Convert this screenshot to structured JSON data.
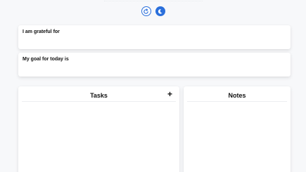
{
  "header": {
    "refresh_icon": "refresh-icon",
    "theme_icon": "moon-icon",
    "accent_color": "#2a6fdb"
  },
  "journal": {
    "grateful_label": "I am grateful for",
    "grateful_value": "",
    "goal_label": "My goal for today is",
    "goal_value": ""
  },
  "panels": {
    "tasks": {
      "title": "Tasks",
      "add_label": "+"
    },
    "notes": {
      "title": "Notes"
    }
  }
}
